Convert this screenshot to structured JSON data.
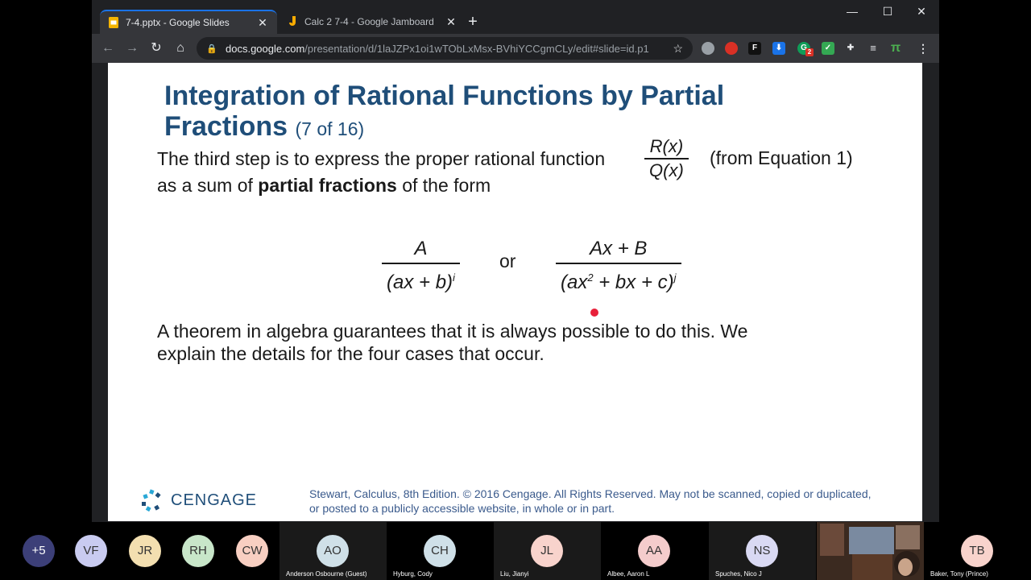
{
  "browser": {
    "tabs": [
      {
        "title": "7-4.pptx - Google Slides",
        "active": true
      },
      {
        "title": "Calc 2 7-4 - Google Jamboard",
        "active": false
      }
    ],
    "url_host": "docs.google.com",
    "url_path": "/presentation/d/1laJZPx1oi1wTObLxMsx-BVhiYCCgmCLy/edit#slide=id.p1",
    "extensions": [
      {
        "icon": "G",
        "badge": "2"
      }
    ]
  },
  "slide": {
    "title_line1": "Integration of Rational Functions by Partial",
    "title_line2": "Fractions",
    "title_counter": "(7 of 16)",
    "para1_a": "The third step is to express the proper rational function",
    "para1_b": "(from Equation 1)",
    "para1_c": "as a sum of",
    "para1_bold": "partial fractions",
    "para1_d": "of the form",
    "ratio_num": "R(x)",
    "ratio_den": "Q(x)",
    "frac1_num": "A",
    "frac1_den": "(ax + b)",
    "frac1_exp": "i",
    "or_label": "or",
    "frac2_num": "Ax + B",
    "frac2_den_a": "(ax",
    "frac2_den_sq": "2",
    "frac2_den_b": " + bx + c)",
    "frac2_exp": "j",
    "para2_line1": "A theorem in algebra guarantees that it is always possible to do this. We",
    "para2_line2": "explain the details for the four cases that occur.",
    "logo_text": "CENGAGE",
    "copyright_line1": "Stewart, Calculus, 8th Edition. © 2016 Cengage. All Rights Reserved. May not be scanned, copied or duplicated,",
    "copyright_line2": "or posted to a publicly accessible website, in whole or in part."
  },
  "participants": [
    {
      "initials": "+5",
      "name": "",
      "color": "#3c3f78"
    },
    {
      "initials": "VF",
      "name": "",
      "color": "#c9cbf0"
    },
    {
      "initials": "JR",
      "name": "",
      "color": "#f3dfb0"
    },
    {
      "initials": "RH",
      "name": "",
      "color": "#c8e6c9"
    },
    {
      "initials": "CW",
      "name": "",
      "color": "#f8cfc2"
    },
    {
      "initials": "AO",
      "name": "Anderson Osbourne (Guest)",
      "color": "#cfe0e8"
    },
    {
      "initials": "CH",
      "name": "Hyburg, Cody",
      "color": "#cfe0e8"
    },
    {
      "initials": "JL",
      "name": "Liu, Jianyi",
      "color": "#f8d3cc"
    },
    {
      "initials": "AA",
      "name": "Albee, Aaron L",
      "color": "#f4cccc"
    },
    {
      "initials": "NS",
      "name": "Spuches, Nico J",
      "color": "#d9d9f3"
    },
    {
      "initials": "TB",
      "name": "Baker, Tony (Prince)",
      "color": "#f8d3cc"
    }
  ]
}
